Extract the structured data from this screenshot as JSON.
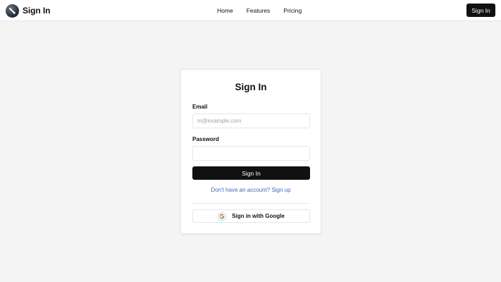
{
  "header": {
    "brand": "Sign In",
    "nav": [
      "Home",
      "Features",
      "Pricing"
    ],
    "sign_in_button": "Sign In"
  },
  "card": {
    "title": "Sign In",
    "email_label": "Email",
    "email_placeholder": "m@example.com",
    "email_value": "",
    "password_label": "Password",
    "password_value": "",
    "submit_label": "Sign In",
    "signup_link": "Don't have an account? Sign up",
    "google_button": "Sign in with Google"
  },
  "colors": {
    "page_background": "#f4f4f5",
    "primary": "#111111",
    "link": "#3b6bc4"
  },
  "icons": [
    "logo-icon",
    "google-icon"
  ]
}
